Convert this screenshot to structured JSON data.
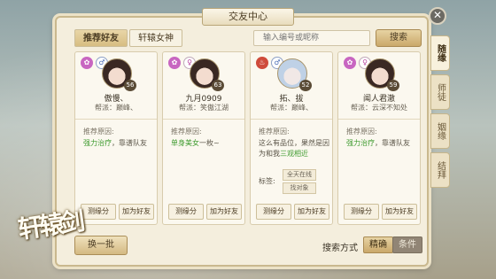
{
  "window": {
    "title": "交友中心",
    "close_label": "✕"
  },
  "tabs": [
    {
      "label": "推荐好友"
    },
    {
      "label": "轩辕女神"
    }
  ],
  "search": {
    "placeholder": "输入编号或昵称",
    "button_label": "搜索"
  },
  "side_tabs": [
    {
      "label": "随缘"
    },
    {
      "label": "师徒"
    },
    {
      "label": "姻缘"
    },
    {
      "label": "结拜"
    }
  ],
  "cards": [
    {
      "gender_symbol": "♂",
      "gender": "male",
      "level": "56",
      "name": "傲慢、",
      "guild": "帮派：巅峰、",
      "reason_title": "推荐原因:",
      "reason_highlight": "强力治疗",
      "reason_rest": "，靠谱队友",
      "btn_fate": "测缘分",
      "btn_add": "加为好友"
    },
    {
      "gender_symbol": "♀",
      "gender": "female",
      "level": "63",
      "name": "九月0909",
      "guild": "帮派：笑傲江湖",
      "reason_title": "推荐原因:",
      "reason_highlight": "单身美女",
      "reason_rest": "一枚~",
      "btn_fate": "测缘分",
      "btn_add": "加为好友"
    },
    {
      "gender_symbol": "♂",
      "gender": "male",
      "level": "52",
      "name": "拓、拔",
      "guild": "帮派：巅峰、",
      "reason_title": "推荐原因:",
      "reason_prefix": "这么有品位，果然是因为和我",
      "reason_highlight": "三观相近",
      "tags_label": "标签:",
      "tags": [
        "全天在线",
        "找对象"
      ],
      "btn_fate": "测缘分",
      "btn_add": "加为好友"
    },
    {
      "gender_symbol": "♀",
      "gender": "female",
      "level": "59",
      "name": "闻人君澈",
      "guild": "帮派：云深不知处",
      "reason_title": "推荐原因:",
      "reason_highlight": "强力治疗",
      "reason_rest": "，靠谱队友",
      "btn_fate": "测缘分",
      "btn_add": "加为好友"
    }
  ],
  "footer": {
    "refresh_label": "换一批",
    "search_mode_label": "搜索方式",
    "mode_precise": "精确",
    "mode_condition": "条件"
  },
  "logo_text": "轩辕剑"
}
